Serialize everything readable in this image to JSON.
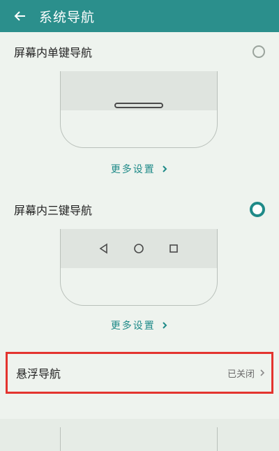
{
  "header": {
    "title": "系统导航",
    "back_icon": "back-arrow-icon"
  },
  "options": [
    {
      "label": "屏幕内单键导航",
      "selected": false,
      "more_settings": "更多设置"
    },
    {
      "label": "屏幕内三键导航",
      "selected": true,
      "more_settings": "更多设置"
    }
  ],
  "floating_nav": {
    "label": "悬浮导航",
    "status": "已关闭",
    "chevron_icon": "chevron-right-icon"
  },
  "icons": {
    "more_settings_chevron": "chevron-right-icon",
    "three_keys": [
      "back-triangle-icon",
      "home-circle-icon",
      "recent-square-icon"
    ]
  },
  "colors": {
    "header_bg": "#2b8f8c",
    "accent": "#1f8a88",
    "highlight_box": "#e3342f",
    "background": "#eef3ee"
  }
}
